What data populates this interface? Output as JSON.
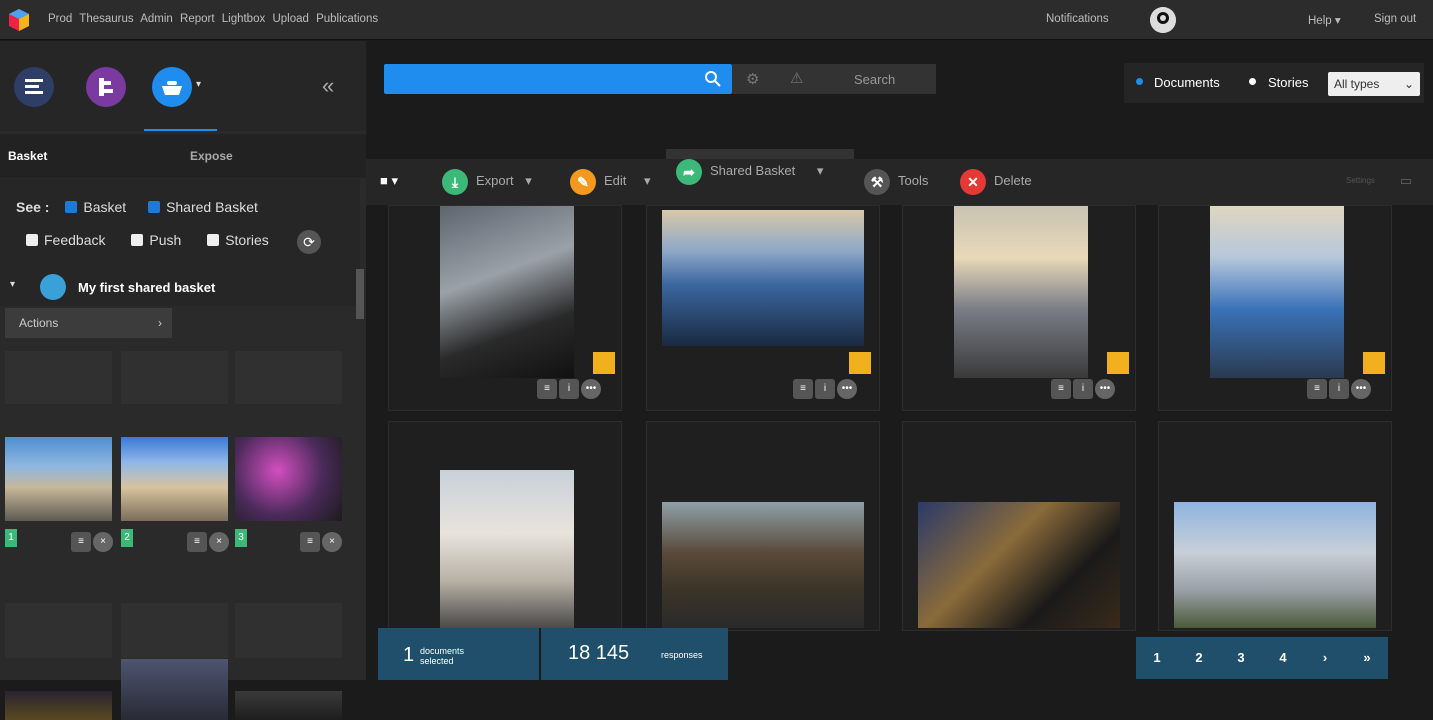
{
  "topnav": {
    "items": [
      "Prod",
      "Thesaurus",
      "Admin",
      "Report",
      "Lightbox",
      "Upload",
      "Publications"
    ],
    "notifications": "Notifications",
    "help": "Help",
    "signout": "Sign out"
  },
  "sidebar": {
    "tabs": [
      "Basket",
      "Expose"
    ],
    "see_label": "See :",
    "checks": [
      {
        "label": "Basket",
        "checked": true
      },
      {
        "label": "Shared Basket",
        "checked": true
      },
      {
        "label": "Feedback",
        "checked": false
      },
      {
        "label": "Push",
        "checked": false
      },
      {
        "label": "Stories",
        "checked": false
      }
    ],
    "basket_name": "My first shared basket",
    "actions": "Actions",
    "thumb_numbers": [
      "1",
      "2",
      "3"
    ]
  },
  "search": {
    "button": "Search"
  },
  "filters": {
    "documents": "Documents",
    "stories": "Stories",
    "select": "All types"
  },
  "toolbar": {
    "export": "Export",
    "edit": "Edit",
    "shared": "Shared Basket",
    "tools": "Tools",
    "delete": "Delete",
    "settings": "Settings"
  },
  "footer": {
    "selected_count": "1",
    "selected_label1": "documents",
    "selected_label2": "selected",
    "responses": "18 145",
    "responses_label": "responses"
  },
  "pager": [
    "1",
    "2",
    "3",
    "4",
    "›",
    "»"
  ],
  "colors": {
    "accent": "#1f8cf0",
    "footer": "#1f4f6a",
    "export": "#3cb878",
    "edit": "#f39a1e",
    "delete": "#e53935"
  }
}
